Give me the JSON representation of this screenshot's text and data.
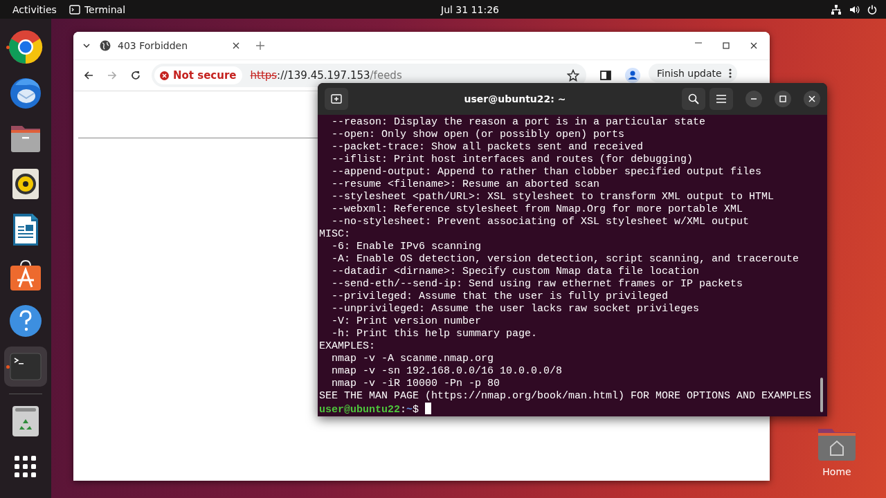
{
  "top_bar": {
    "activities": "Activities",
    "app_name": "Terminal",
    "clock": "Jul 31  11:26"
  },
  "dock": {
    "items": [
      {
        "kind": "browser",
        "running": true,
        "selected": false
      },
      {
        "kind": "mail",
        "running": false,
        "selected": false
      },
      {
        "kind": "files",
        "running": false,
        "selected": false
      },
      {
        "kind": "music",
        "running": false,
        "selected": false
      },
      {
        "kind": "writer",
        "running": false,
        "selected": false
      },
      {
        "kind": "store",
        "running": false,
        "selected": false
      },
      {
        "kind": "help",
        "running": false,
        "selected": false
      },
      {
        "kind": "terminal",
        "running": true,
        "selected": true
      }
    ],
    "trash": {
      "kind": "trash"
    },
    "apps": {
      "kind": "apps"
    }
  },
  "desktop_icons": [
    {
      "label": "Home"
    }
  ],
  "browser": {
    "tabs": [
      {
        "title": "403 Forbidden",
        "selected": true
      }
    ],
    "address": {
      "security": "Not secure",
      "scheme": "https",
      "host": "://139.45.197.153",
      "path": "/feeds"
    },
    "update_button": "Finish update"
  },
  "terminal": {
    "title": "user@ubuntu22: ~",
    "lines": [
      "  --reason: Display the reason a port is in a particular state",
      "  --open: Only show open (or possibly open) ports",
      "  --packet-trace: Show all packets sent and received",
      "  --iflist: Print host interfaces and routes (for debugging)",
      "  --append-output: Append to rather than clobber specified output files",
      "  --resume <filename>: Resume an aborted scan",
      "  --stylesheet <path/URL>: XSL stylesheet to transform XML output to HTML",
      "  --webxml: Reference stylesheet from Nmap.Org for more portable XML",
      "  --no-stylesheet: Prevent associating of XSL stylesheet w/XML output",
      "MISC:",
      "  -6: Enable IPv6 scanning",
      "  -A: Enable OS detection, version detection, script scanning, and traceroute",
      "  --datadir <dirname>: Specify custom Nmap data file location",
      "  --send-eth/--send-ip: Send using raw ethernet frames or IP packets",
      "  --privileged: Assume that the user is fully privileged",
      "  --unprivileged: Assume the user lacks raw socket privileges",
      "  -V: Print version number",
      "  -h: Print this help summary page.",
      "EXAMPLES:",
      "  nmap -v -A scanme.nmap.org",
      "  nmap -v -sn 192.168.0.0/16 10.0.0.0/8",
      "  nmap -v -iR 10000 -Pn -p 80",
      "SEE THE MAN PAGE (https://nmap.org/book/man.html) FOR MORE OPTIONS AND EXAMPLES"
    ],
    "prompt": {
      "user": "user@ubuntu22",
      "separator": ":",
      "path": "~",
      "symbol": "$"
    }
  }
}
